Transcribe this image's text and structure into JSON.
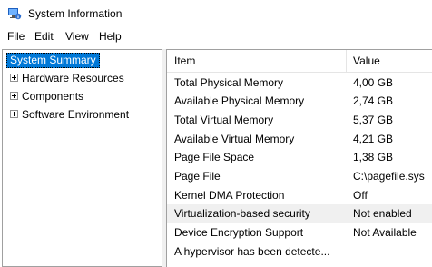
{
  "window": {
    "title": "System Information",
    "icon": "system-information-icon"
  },
  "menubar": {
    "items": [
      "File",
      "Edit",
      "View",
      "Help"
    ]
  },
  "tree": {
    "root": "System Summary",
    "nodes": [
      "Hardware Resources",
      "Components",
      "Software Environment"
    ],
    "expander_icon": "plus-expander-icon"
  },
  "list": {
    "columns": {
      "item": "Item",
      "value": "Value"
    },
    "rows": [
      {
        "item": "Total Physical Memory",
        "value": "4,00 GB"
      },
      {
        "item": "Available Physical Memory",
        "value": "2,74 GB"
      },
      {
        "item": "Total Virtual Memory",
        "value": "5,37 GB"
      },
      {
        "item": "Available Virtual Memory",
        "value": "4,21 GB"
      },
      {
        "item": "Page File Space",
        "value": "1,38 GB"
      },
      {
        "item": "Page File",
        "value": "C:\\pagefile.sys"
      },
      {
        "item": "Kernel DMA Protection",
        "value": "Off"
      },
      {
        "item": "Virtualization-based security",
        "value": "Not enabled"
      },
      {
        "item": "Device Encryption Support",
        "value": "Not Available"
      },
      {
        "item": "A hypervisor has been detecte...",
        "value": ""
      }
    ],
    "selected_row_index": 7
  },
  "colors": {
    "selection_blue": "#0078d7",
    "row_highlight": "#f0f0f0",
    "border": "#a0a0a0"
  }
}
